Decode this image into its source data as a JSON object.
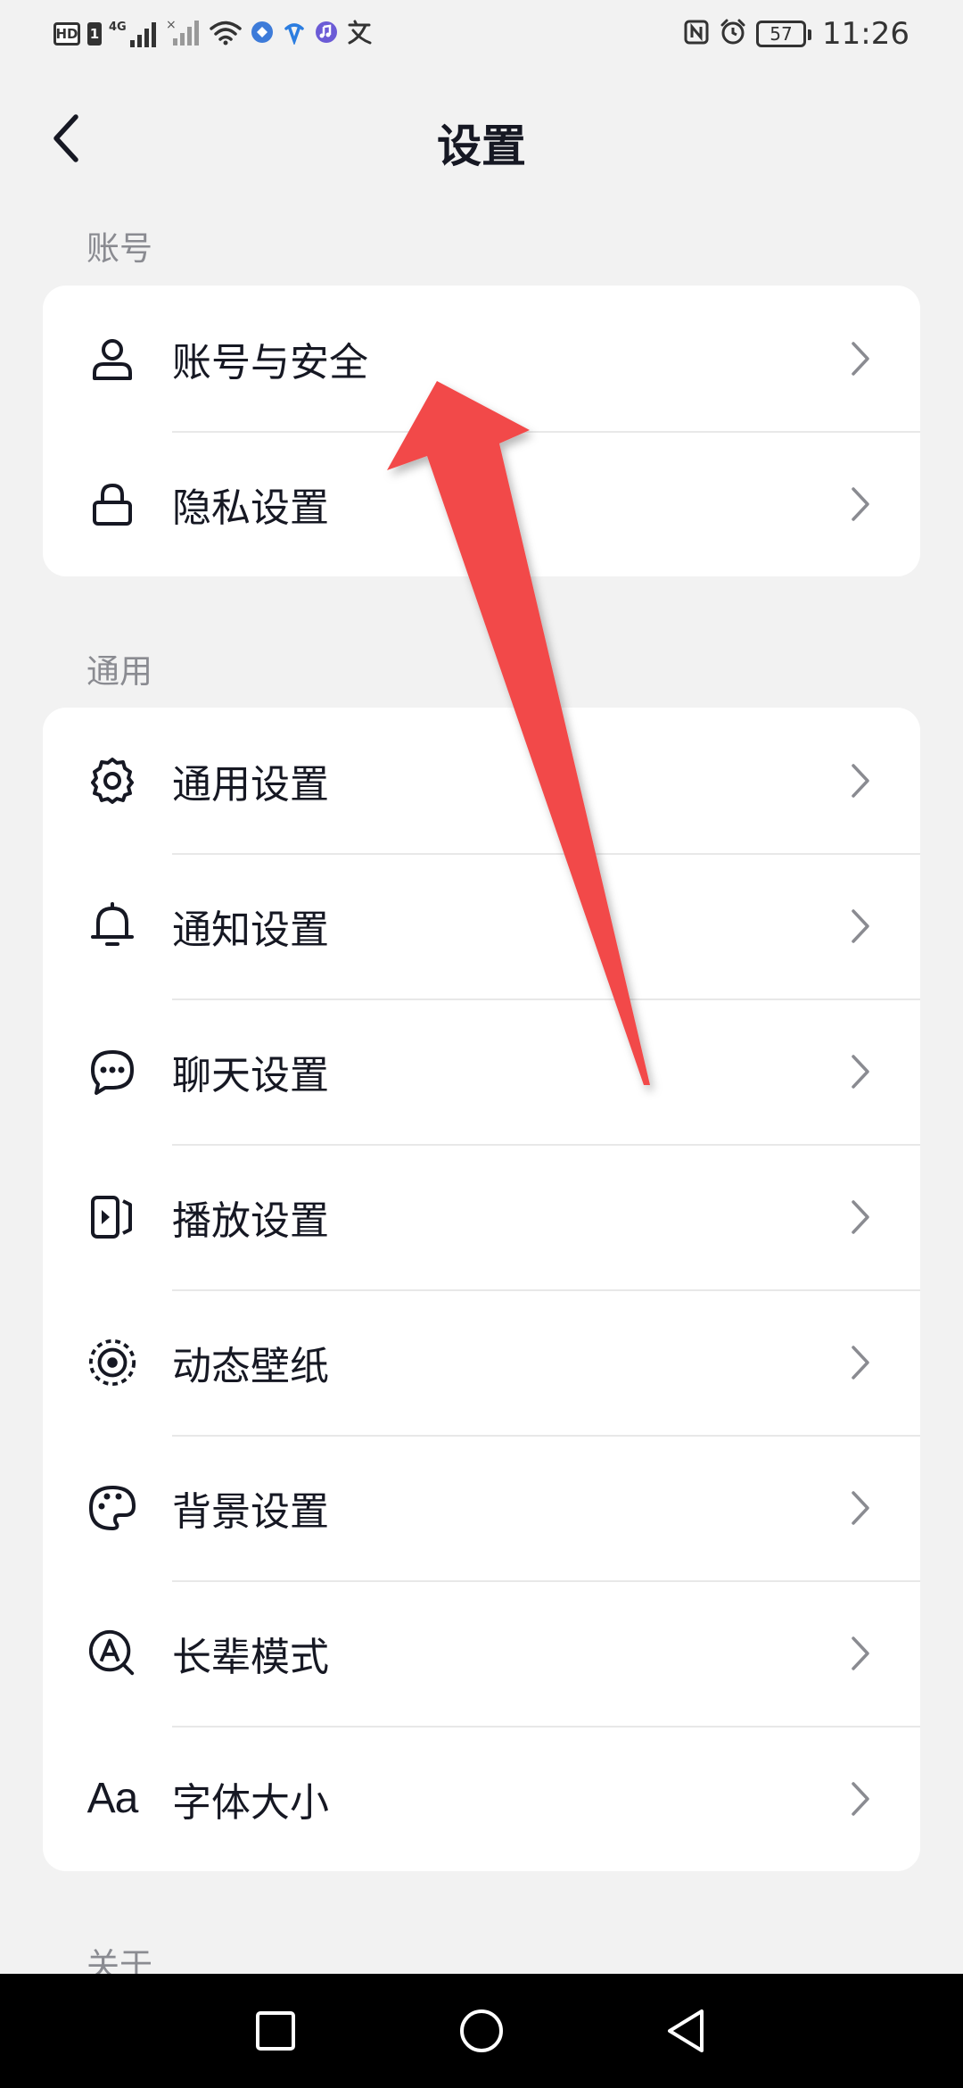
{
  "status_bar": {
    "hd": "HD",
    "sim": "1",
    "network": "4G",
    "battery": "57",
    "time": "11:26",
    "icons": [
      "hd-icon",
      "signal-icon",
      "wifi-icon",
      "app-notification-icons",
      "nfc-icon",
      "alarm-icon",
      "battery-icon"
    ]
  },
  "header": {
    "title": "设置",
    "back_icon": "chevron-left-icon"
  },
  "sections": {
    "account": {
      "label": "账号",
      "items": [
        {
          "label": "账号与安全",
          "icon": "person-icon"
        },
        {
          "label": "隐私设置",
          "icon": "lock-icon"
        }
      ]
    },
    "general": {
      "label": "通用",
      "items": [
        {
          "label": "通用设置",
          "icon": "gear-icon"
        },
        {
          "label": "通知设置",
          "icon": "bell-icon"
        },
        {
          "label": "聊天设置",
          "icon": "chat-bubble-icon"
        },
        {
          "label": "播放设置",
          "icon": "play-icon"
        },
        {
          "label": "动态壁纸",
          "icon": "target-icon"
        },
        {
          "label": "背景设置",
          "icon": "palette-icon"
        },
        {
          "label": "长辈模式",
          "icon": "elder-mode-icon"
        },
        {
          "label": "字体大小",
          "icon": "font-size-icon",
          "glyph": "Aa"
        }
      ]
    },
    "about": {
      "label": "关于"
    }
  },
  "annotation": {
    "color": "#f24848"
  },
  "colors": {
    "background": "#f2f2f2",
    "card": "#ffffff",
    "text": "#161823",
    "secondary_text": "#8a8b91",
    "divider": "#e8e8e8",
    "chevron": "#8a8b91"
  },
  "nav_bar": {
    "buttons": [
      "recent-apps-button",
      "home-button",
      "back-button"
    ]
  }
}
